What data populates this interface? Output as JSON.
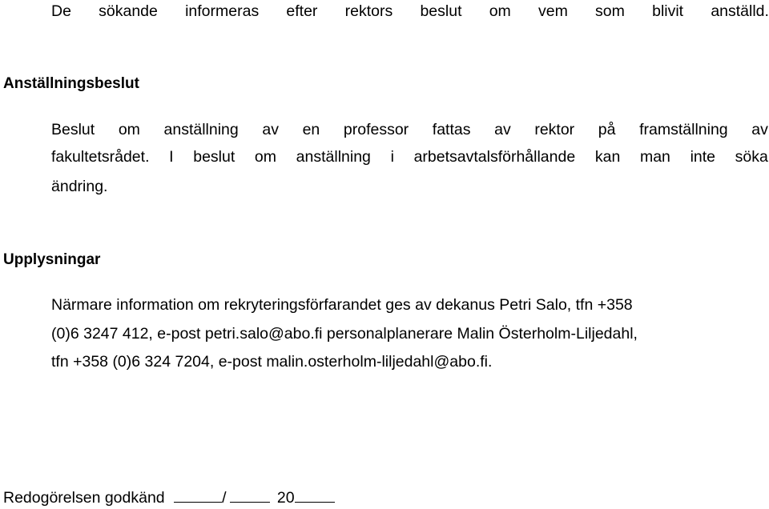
{
  "intro": {
    "words": [
      "De",
      "sökande",
      "informeras",
      "efter",
      "rektors",
      "beslut",
      "om",
      "vem",
      "som",
      "blivit",
      "anställd."
    ]
  },
  "section_decision": {
    "heading": "Anställningsbeslut",
    "line1_words": [
      "Beslut",
      "om",
      "anställning",
      "av",
      "en",
      "professor",
      "fattas",
      "av",
      "rektor",
      "på",
      "framställning",
      "av"
    ],
    "line2_words": [
      "fakultetsrådet.",
      "I",
      "beslut",
      "om",
      "anställning",
      "i",
      "arbetsavtalsförhållande",
      "kan",
      "man",
      "inte",
      "söka"
    ],
    "line3": "ändring."
  },
  "section_info": {
    "heading": "Upplysningar",
    "line1": "Närmare information om rekryteringsförfarandet ges av dekanus Petri Salo, tfn +358",
    "line2": "(0)6 3247 412, e-post petri.salo@abo.fi personalplanerare Malin Österholm-Liljedahl,",
    "line3": "tfn +358 (0)6 324 7204, e-post malin.osterholm-liljedahl@abo.fi."
  },
  "approval": {
    "label": "Redogörelsen godkänd",
    "separator": "/",
    "year_prefix": "20"
  }
}
